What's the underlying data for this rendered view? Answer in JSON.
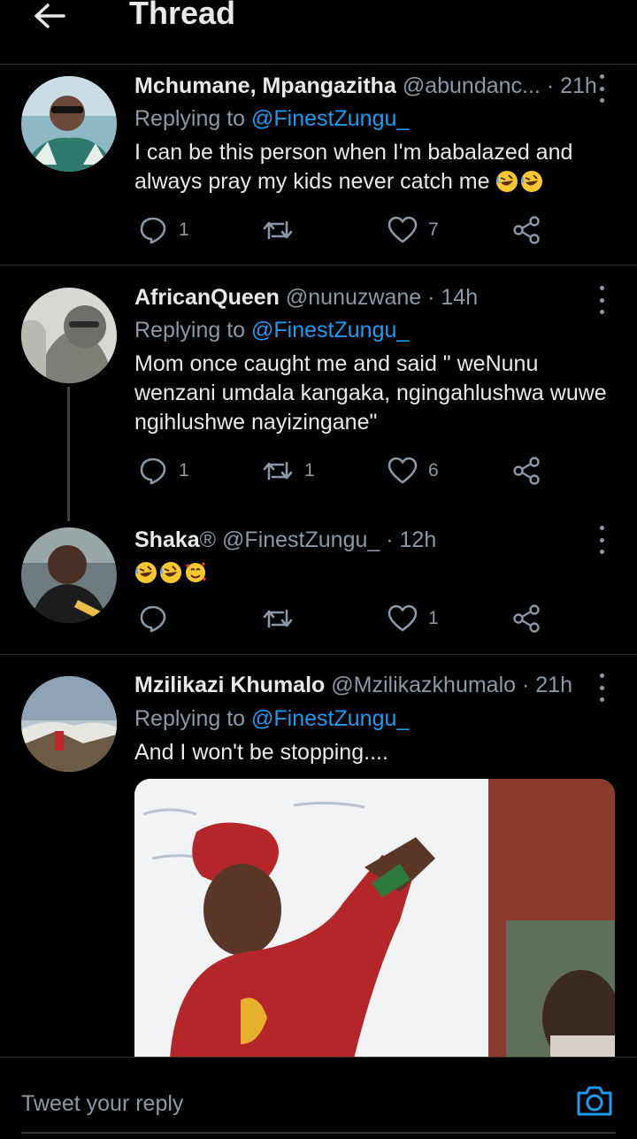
{
  "header": {
    "title": "Thread"
  },
  "tweets": [
    {
      "name": "Mchumane, Mpangazitha",
      "handle": "@abundanc...",
      "dot": "·",
      "time": "21h",
      "replying_prefix": "Replying to",
      "replying_to": "@FinestZungu_",
      "text": "I can be this person when I'm babalazed and always pray my kids never catch me",
      "reply_count": "1",
      "retweet_count": "",
      "like_count": "7"
    },
    {
      "name": "AfricanQueen",
      "handle": "@nunuzwane",
      "dot": "·",
      "time": "14h",
      "replying_prefix": "Replying to",
      "replying_to": "@FinestZungu_",
      "text": "Mom once caught me and said \" weNunu wenzani umdala kangaka, ngingahlushwa wuwe ngihlushwe nayizingane\"",
      "reply_count": "1",
      "retweet_count": "1",
      "like_count": "6"
    },
    {
      "name": "Shaka",
      "badge": "®",
      "handle": "@FinestZungu_",
      "dot": "·",
      "time": "12h",
      "reply_count": "",
      "retweet_count": "",
      "like_count": "1"
    },
    {
      "name": "Mzilikazi Khumalo",
      "handle": "@Mzilikazkhumalo",
      "dot": "·",
      "time": "21h",
      "replying_prefix": "Replying to",
      "replying_to": "@FinestZungu_",
      "text": "And I won't be stopping...."
    }
  ],
  "reply_bar": {
    "placeholder": "Tweet your reply"
  },
  "colors": {
    "accent": "#1d9bf0",
    "muted": "#8b98a5",
    "background": "#000000",
    "divider": "#2f3336"
  }
}
